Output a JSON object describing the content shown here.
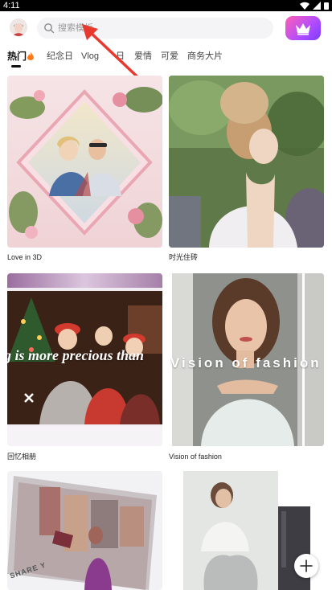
{
  "status_bar": {
    "time": "4:11"
  },
  "header": {
    "search_placeholder": "搜索模板",
    "avatar_icon": "profile-avatar",
    "vip_icon": "crown-icon"
  },
  "tabs": [
    {
      "label": "热门",
      "active": true
    },
    {
      "label": "纪念日"
    },
    {
      "label": "Vlog"
    },
    {
      "label": "日"
    },
    {
      "label": "爱情"
    },
    {
      "label": "可爱"
    },
    {
      "label": "商务大片"
    }
  ],
  "cards": [
    {
      "caption": "Love in 3D"
    },
    {
      "caption": "时光住砖"
    },
    {
      "caption": "回忆相册",
      "overlay_text": "g is more precious than"
    },
    {
      "caption": "Vision of  fashion",
      "overlay_text": "Vision of  fashion"
    },
    {
      "caption": "",
      "overlay_text": "SHARE Y"
    },
    {
      "caption": ""
    }
  ],
  "colors": {
    "vip_gradient_start": "#ff5fb4",
    "vip_gradient_end": "#7a3cff",
    "annotation_arrow": "#e8392e"
  }
}
